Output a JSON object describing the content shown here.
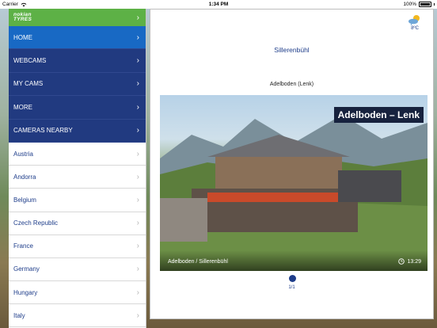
{
  "status_bar": {
    "carrier": "Carrier",
    "time": "1:34 PM",
    "battery": "100%"
  },
  "sidebar": {
    "brand_lines": [
      "nokian",
      "TYRES"
    ],
    "menu": [
      {
        "label": "HOME",
        "active": true
      },
      {
        "label": "WEBCAMS",
        "active": false
      },
      {
        "label": "MY CAMS",
        "active": false
      },
      {
        "label": "MORE",
        "active": false
      },
      {
        "label": "CAMERAS NEARBY",
        "active": false
      }
    ],
    "countries": [
      "Austria",
      "Andorra",
      "Belgium",
      "Czech Republic",
      "France",
      "Germany",
      "Hungary",
      "Italy"
    ]
  },
  "main": {
    "weather_temp": "8ºC",
    "title": "Sillerenbühl",
    "subtitle": "Adelboden (Lenk)",
    "image_overlay_title": "Adelboden – Lenk",
    "image_caption": "Adelboden / Sillerenbühl",
    "image_time": "13:29",
    "pager": "1/1"
  }
}
